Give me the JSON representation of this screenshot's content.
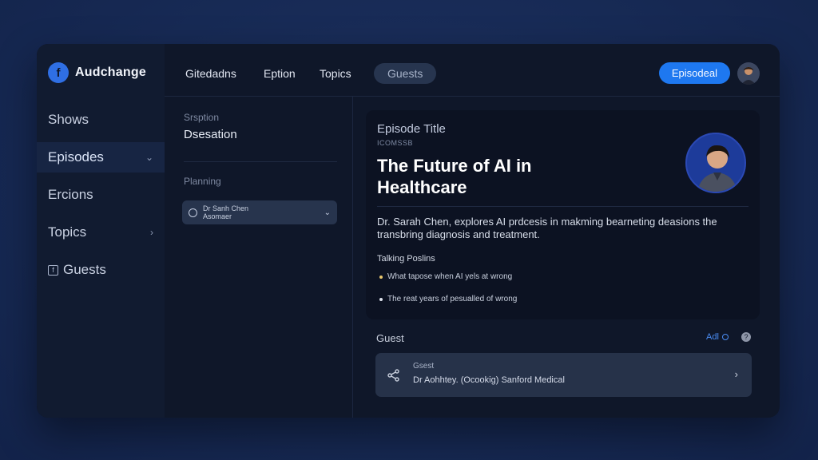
{
  "brand": {
    "name": "Audchange",
    "logo_letter": "f",
    "accent": "#2f6fe4"
  },
  "sidebar": {
    "items": [
      {
        "label": "Shows",
        "active": false
      },
      {
        "label": "Episodes",
        "active": true,
        "chevron": "chevron-down-icon"
      },
      {
        "label": "Ercions",
        "active": false
      },
      {
        "label": "Topics",
        "active": false,
        "chevron": "chevron-right-icon"
      },
      {
        "label": "Guests",
        "active": false,
        "icon": "guest-icon"
      }
    ]
  },
  "topbar": {
    "tabs": [
      "Gitedadns",
      "Eption",
      "Topics",
      "Guests"
    ],
    "primary_button": "Episodeal",
    "primary_color": "#1e78f0"
  },
  "middle": {
    "section1_label": "Srsption",
    "section1_value": "Dsesation",
    "section2_label": "Planning",
    "select_line1": "Dr Sanh Chen",
    "select_line2": "Asomaer"
  },
  "episode": {
    "label": "Episode Title",
    "meta": "ICOMSSB",
    "title": "The Future of AI in Healthcare",
    "description": "Dr. Sarah Chen, explores AI prdcesis in makming bearneting deasions the transbring diagnosis and treatment.",
    "talking_points_label": "Talking Poslins",
    "talking_points": [
      "What tapose when AI yels at wrong",
      "The reat years of pesualled of wrong"
    ]
  },
  "guest": {
    "section_label": "Guest",
    "add_label": "Adl",
    "row_label": "Gsest",
    "row_value": "Dr Aohhtey. (Ocookig) Sanford Medical"
  }
}
